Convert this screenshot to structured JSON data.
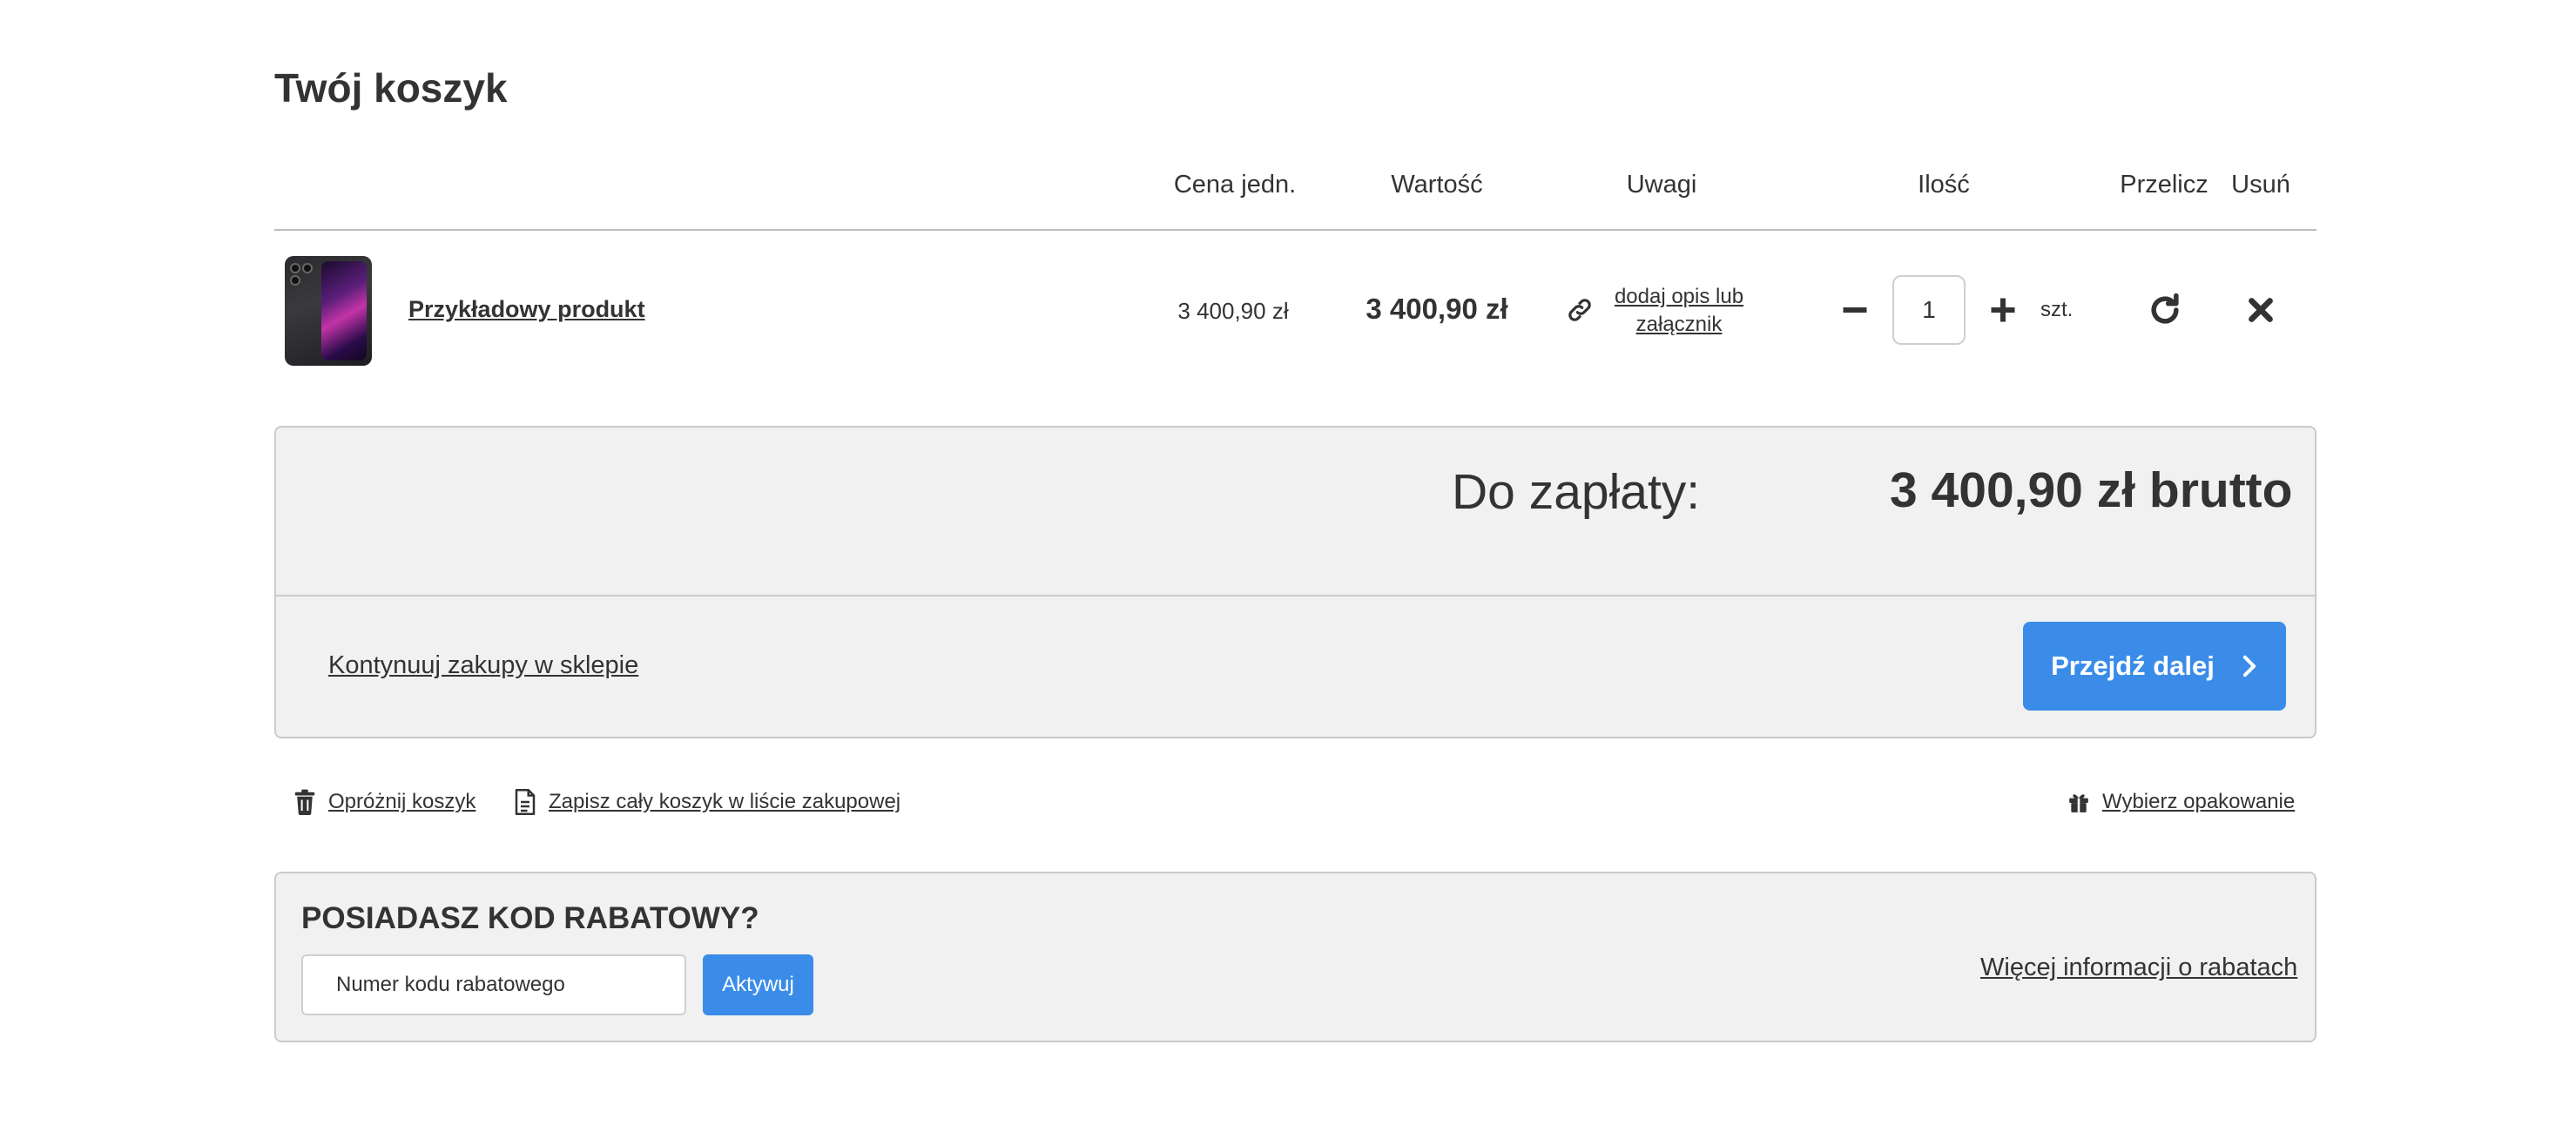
{
  "page": {
    "title": "Twój koszyk"
  },
  "table": {
    "headers": {
      "unit_price": "Cena jedn.",
      "value": "Wartość",
      "notes": "Uwagi",
      "quantity": "Ilość",
      "recalc": "Przelicz",
      "remove": "Usuń"
    }
  },
  "item": {
    "name": "Przykładowy produkt",
    "unit_price": "3 400,90 zł",
    "value": "3 400,90 zł",
    "notes_link": "dodaj opis lub załącznik",
    "quantity": "1",
    "unit": "szt.",
    "icons": {
      "notes": "link-icon",
      "decrease": "minus-icon",
      "increase": "plus-icon",
      "recalc": "refresh-icon",
      "remove": "close-icon"
    }
  },
  "summary": {
    "due_label": "Do zapłaty:",
    "due_value": "3 400,90 zł brutto",
    "continue_link": "Kontynuuj zakupy w sklepie",
    "next_button": "Przejdź dalej"
  },
  "actions": {
    "empty_cart": "Opróżnij koszyk",
    "save_list": "Zapisz cały koszyk w liście zakupowej",
    "packaging": "Wybierz opakowanie"
  },
  "promo": {
    "title": "POSIADASZ KOD RABATOWY?",
    "placeholder": "Numer kodu rabatowego",
    "button": "Aktywuj",
    "info_link": "Więcej informacji o rabatach"
  },
  "colors": {
    "accent": "#3a8ce8",
    "panel": "#f1f1f1",
    "text": "#333333"
  }
}
